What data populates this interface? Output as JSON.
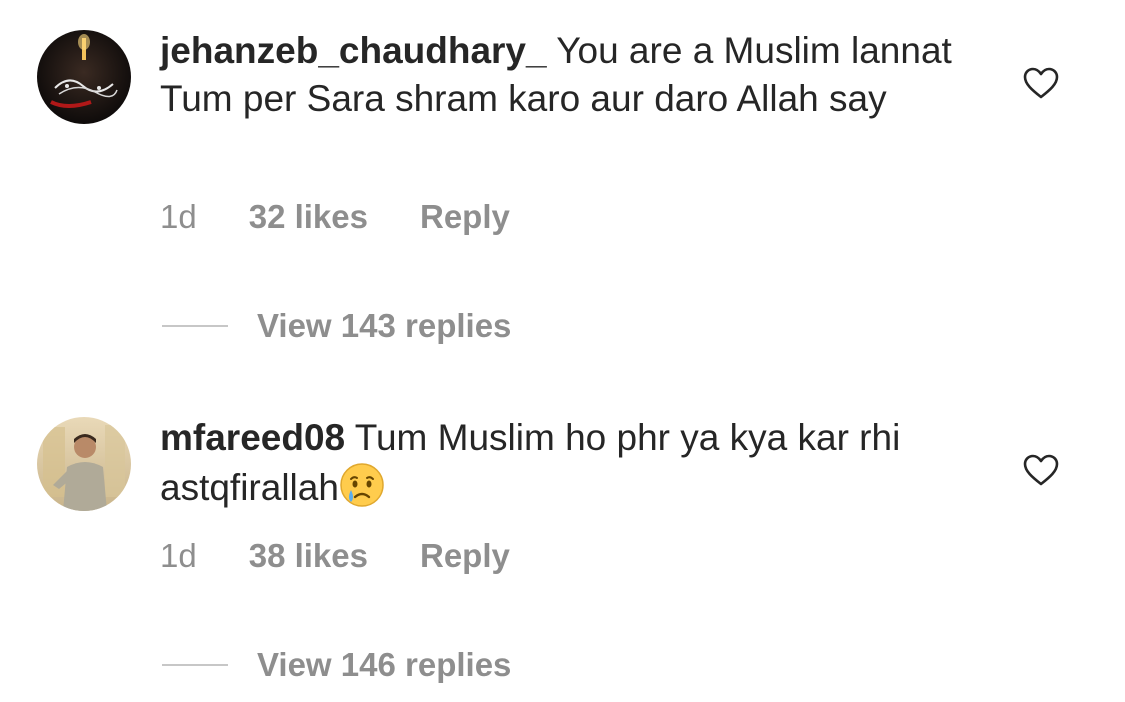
{
  "comments": [
    {
      "username": "jehanzeb_chaudhary_",
      "text": "You are a Muslim lannat Tum per Sara shram karo aur daro Allah say",
      "time": "1d",
      "likes": "32 likes",
      "reply_label": "Reply",
      "view_replies": "View 143 replies",
      "avatar_icon": "dark-calligraphy-avatar",
      "liked": false
    },
    {
      "username": "mfareed08",
      "text": "Tum Muslim ho phr ya kya kar rhi astqfirallah",
      "emoji": "crying-face",
      "time": "1d",
      "likes": "38 likes",
      "reply_label": "Reply",
      "view_replies": "View 146 replies",
      "avatar_icon": "person-photo-avatar",
      "liked": false
    }
  ],
  "colors": {
    "primary_text": "#262626",
    "secondary_text": "#8e8e8e",
    "divider": "#c7c7c7"
  }
}
